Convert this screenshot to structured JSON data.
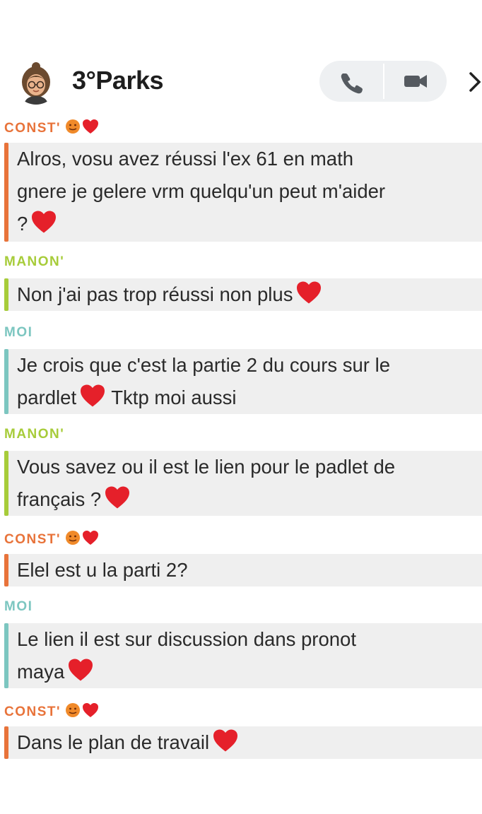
{
  "header": {
    "title": "3°Parks"
  },
  "colors": {
    "const": "#e8733a",
    "manon": "#a7cc3a",
    "moi": "#7cc6c0",
    "bubble": "#efefef",
    "heart": "#e5202a"
  },
  "messages": [
    {
      "sender": "CONST'",
      "who": "const",
      "text": "Alros, vosu avez réussi l'ex 61 en math\ngnere je gelere vrm quelqu'un peut m'aider\n?",
      "heart": true
    },
    {
      "sender": "MANON'",
      "who": "manon",
      "text": "Non j'ai pas trop réussi non plus",
      "heart": true
    },
    {
      "sender": "MOI",
      "who": "moi",
      "text": "Je crois que c'est la partie 2 du cours sur le\npardlet",
      "text2": "Tktp moi aussi",
      "heart": true
    },
    {
      "sender": "MANON'",
      "who": "manon",
      "text": "Vous savez ou il est le lien pour le padlet de\nfrançais ?",
      "heart": true
    },
    {
      "sender": "CONST'",
      "who": "const",
      "text": "Elel est u la parti 2?",
      "heart": false
    },
    {
      "sender": "MOI",
      "who": "moi",
      "text": "Le lien il est sur discussion dans pronot\nmaya",
      "heart": true
    },
    {
      "sender": "CONST'",
      "who": "const",
      "text": "Dans le plan de travail",
      "heart": true
    }
  ]
}
